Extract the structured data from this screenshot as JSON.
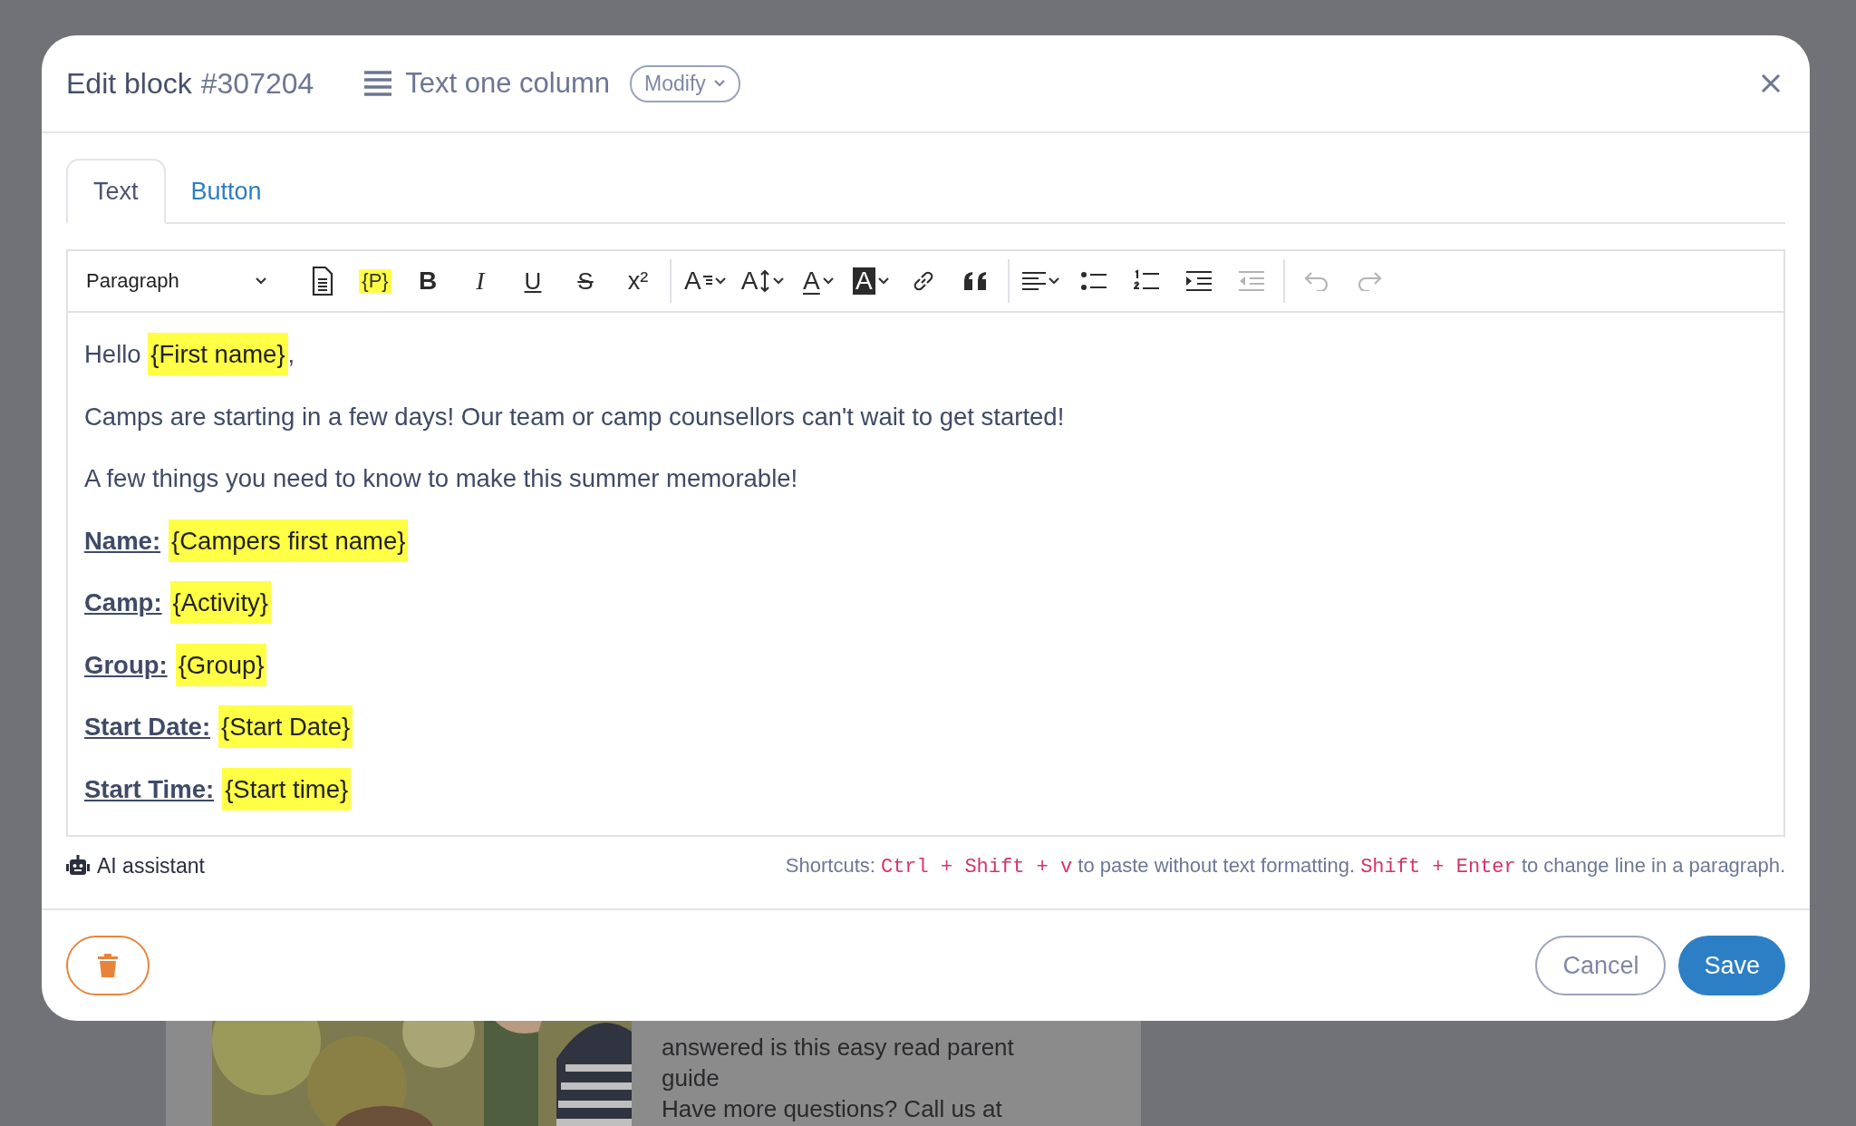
{
  "background": {
    "lines": [
      "answered is this easy read parent",
      "guide",
      "Have more questions? Call us at"
    ]
  },
  "dialog": {
    "title": "Edit block",
    "block_id": "#307204",
    "block_type": "Text one column",
    "modify_button": "Modify"
  },
  "tabs": [
    {
      "label": "Text",
      "selected": true
    },
    {
      "label": "Button",
      "selected": false
    }
  ],
  "toolbar": {
    "format_select": "Paragraph",
    "groups": [
      [
        {
          "kind": "source",
          "disabled": false
        },
        {
          "kind": "placeholder",
          "glyph": "{P}",
          "disabled": false
        },
        {
          "kind": "bold",
          "glyph": "B",
          "disabled": false
        },
        {
          "kind": "italic",
          "glyph": "I",
          "disabled": false
        },
        {
          "kind": "underline",
          "glyph": "U",
          "disabled": false
        },
        {
          "kind": "strike",
          "glyph": "S",
          "disabled": false
        },
        {
          "kind": "superscript",
          "glyph": "x²",
          "disabled": false
        }
      ],
      [
        {
          "kind": "font_family",
          "glyph": "A",
          "disabled": false
        },
        {
          "kind": "font_size",
          "glyph": "A",
          "disabled": false
        },
        {
          "kind": "font_color",
          "glyph": "A",
          "disabled": false
        },
        {
          "kind": "highlight",
          "glyph": "A",
          "disabled": false
        },
        {
          "kind": "link",
          "disabled": false
        },
        {
          "kind": "quote",
          "disabled": false
        }
      ],
      [
        {
          "kind": "align",
          "disabled": false
        },
        {
          "kind": "bullets",
          "disabled": false
        },
        {
          "kind": "numbers",
          "disabled": false
        },
        {
          "kind": "indent",
          "disabled": false
        },
        {
          "kind": "outdent",
          "disabled": true
        }
      ],
      [
        {
          "kind": "undo",
          "disabled": true
        },
        {
          "kind": "redo",
          "disabled": true
        }
      ]
    ]
  },
  "content": [
    [
      {
        "kind": "plain",
        "text": "Hello "
      },
      {
        "kind": "field",
        "text": "{First name}"
      },
      {
        "kind": "plain",
        "text": ","
      }
    ],
    [
      {
        "kind": "plain",
        "text": "Camps are starting in a few days! Our team or camp counsellors can't wait to get started!"
      }
    ],
    [
      {
        "kind": "plain",
        "text": "A few things you need to know to make this summer memorable!"
      }
    ],
    [
      {
        "kind": "label",
        "text": "Name:"
      },
      {
        "kind": "field",
        "text": "{Campers first name}"
      }
    ],
    [
      {
        "kind": "label",
        "text": "Camp:"
      },
      {
        "kind": "field",
        "text": "{Activity}"
      }
    ],
    [
      {
        "kind": "label",
        "text": "Group:"
      },
      {
        "kind": "field",
        "text": "{Group}"
      }
    ],
    [
      {
        "kind": "label",
        "text": "Start Date:"
      },
      {
        "kind": "field",
        "text": "{Start Date}"
      }
    ],
    [
      {
        "kind": "label",
        "text": "Start Time:"
      },
      {
        "kind": "field",
        "text": "{Start time}"
      }
    ]
  ],
  "ai_assistant": "AI assistant",
  "shortcuts": [
    {
      "kind": "plain",
      "text": "Shortcuts: "
    },
    {
      "kind": "code",
      "text": "Ctrl + Shift + v"
    },
    {
      "kind": "plain",
      "text": " to paste without text formatting. "
    },
    {
      "kind": "code",
      "text": "Shift + Enter"
    },
    {
      "kind": "plain",
      "text": " to change line in a paragraph."
    }
  ],
  "footer": {
    "cancel_button": "Cancel",
    "save_button": "Save"
  }
}
